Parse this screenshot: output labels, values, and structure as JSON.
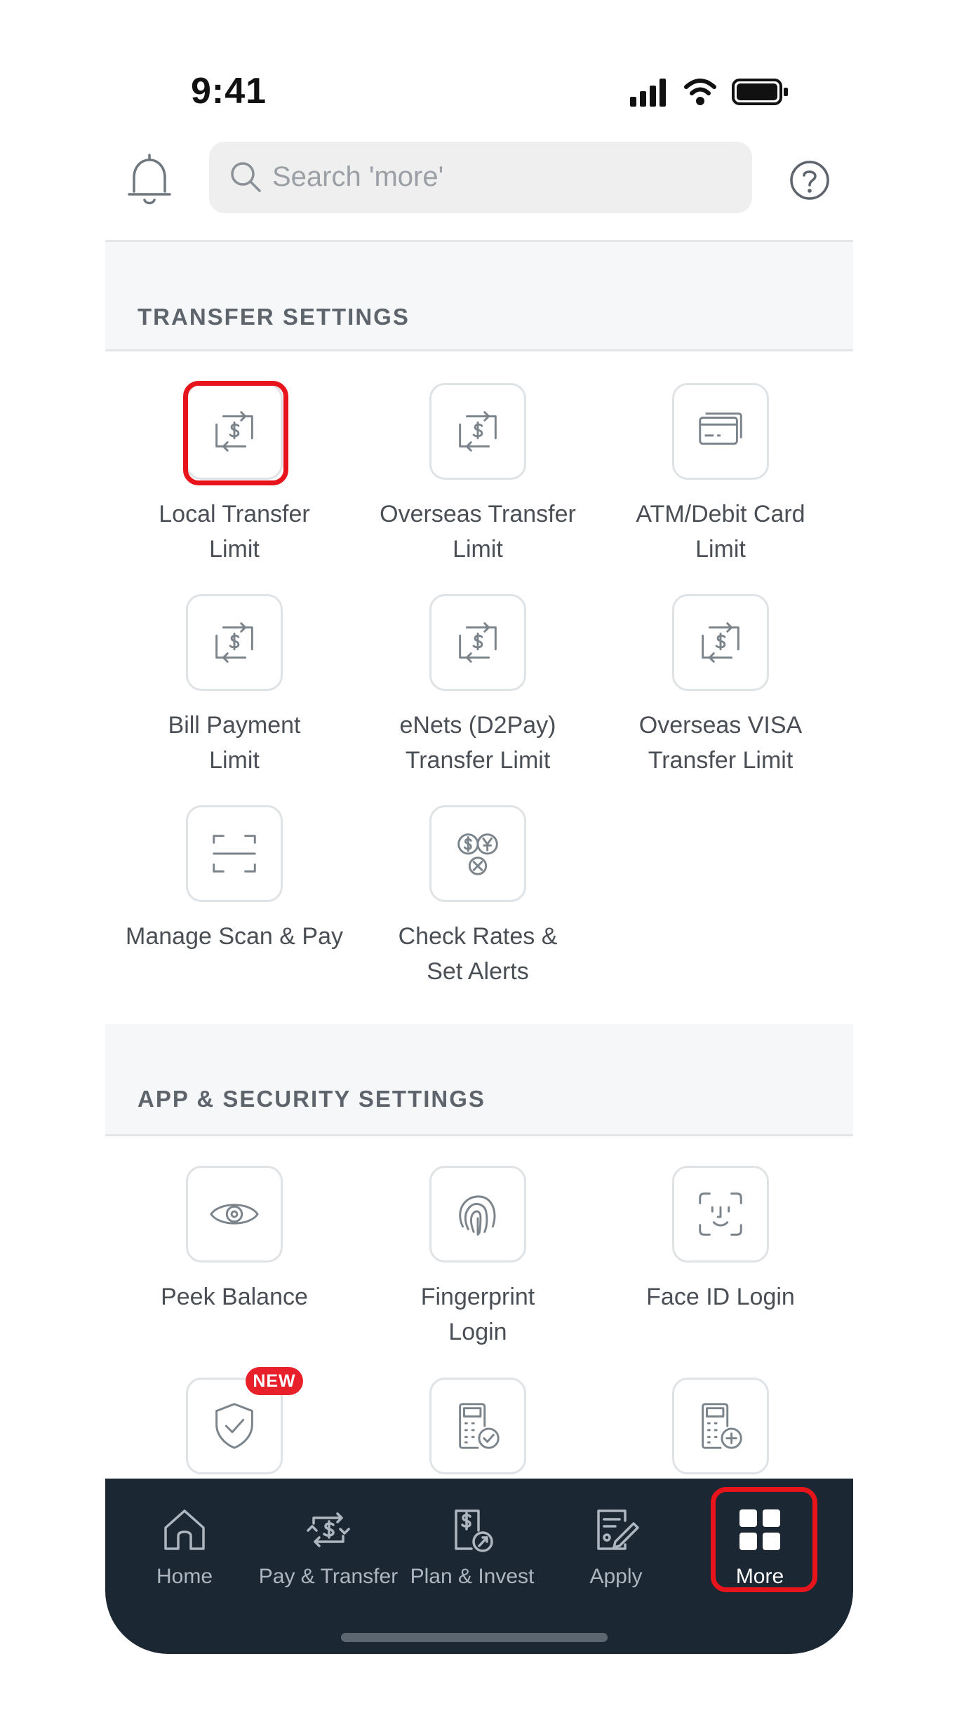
{
  "status_bar": {
    "time": "9:41"
  },
  "header": {
    "search_placeholder": "Search 'more'"
  },
  "sections": [
    {
      "title": "TRANSFER SETTINGS",
      "items": [
        {
          "label_line1": "Local Transfer",
          "label_line2": "Limit",
          "icon": "transfer-dollar-icon"
        },
        {
          "label_line1": "Overseas Transfer",
          "label_line2": "Limit",
          "icon": "transfer-dollar-icon"
        },
        {
          "label_line1": "ATM/Debit Card",
          "label_line2": "Limit",
          "icon": "card-icon"
        },
        {
          "label_line1": "Bill Payment",
          "label_line2": "Limit",
          "icon": "transfer-dollar-icon"
        },
        {
          "label_line1": "eNets (D2Pay)",
          "label_line2": "Transfer Limit",
          "icon": "transfer-dollar-icon"
        },
        {
          "label_line1": "Overseas VISA",
          "label_line2": "Transfer Limit",
          "icon": "transfer-dollar-icon"
        },
        {
          "label_line1": "Manage Scan & Pay",
          "label_line2": "",
          "icon": "scan-frame-icon"
        },
        {
          "label_line1": "Check Rates &",
          "label_line2": "Set Alerts",
          "icon": "currency-exchange-icon"
        }
      ]
    },
    {
      "title": "APP & SECURITY SETTINGS",
      "items": [
        {
          "label_line1": "Peek Balance",
          "label_line2": "",
          "icon": "eye-icon"
        },
        {
          "label_line1": "Fingerprint",
          "label_line2": "Login",
          "icon": "fingerprint-icon"
        },
        {
          "label_line1": "Face ID Login",
          "label_line2": "",
          "icon": "face-id-icon"
        },
        {
          "label_line1": "",
          "label_line2": "",
          "icon": "shield-check-icon",
          "badge": "NEW"
        },
        {
          "label_line1": "",
          "label_line2": "",
          "icon": "calculator-check-icon"
        },
        {
          "label_line1": "",
          "label_line2": "",
          "icon": "calculator-plus-icon"
        }
      ]
    }
  ],
  "bottom_nav": [
    {
      "label": "Home",
      "icon": "home-icon"
    },
    {
      "label": "Pay & Transfer",
      "icon": "pay-transfer-icon"
    },
    {
      "label": "Plan & Invest",
      "icon": "plan-invest-icon"
    },
    {
      "label": "Apply",
      "icon": "apply-icon"
    },
    {
      "label": "More",
      "icon": "grid-icon",
      "active": true
    }
  ],
  "colors": {
    "nav_background": "#1b2833",
    "highlight": "#e8141b",
    "badge": "#e8202a",
    "section_background": "#f6f7f8"
  }
}
